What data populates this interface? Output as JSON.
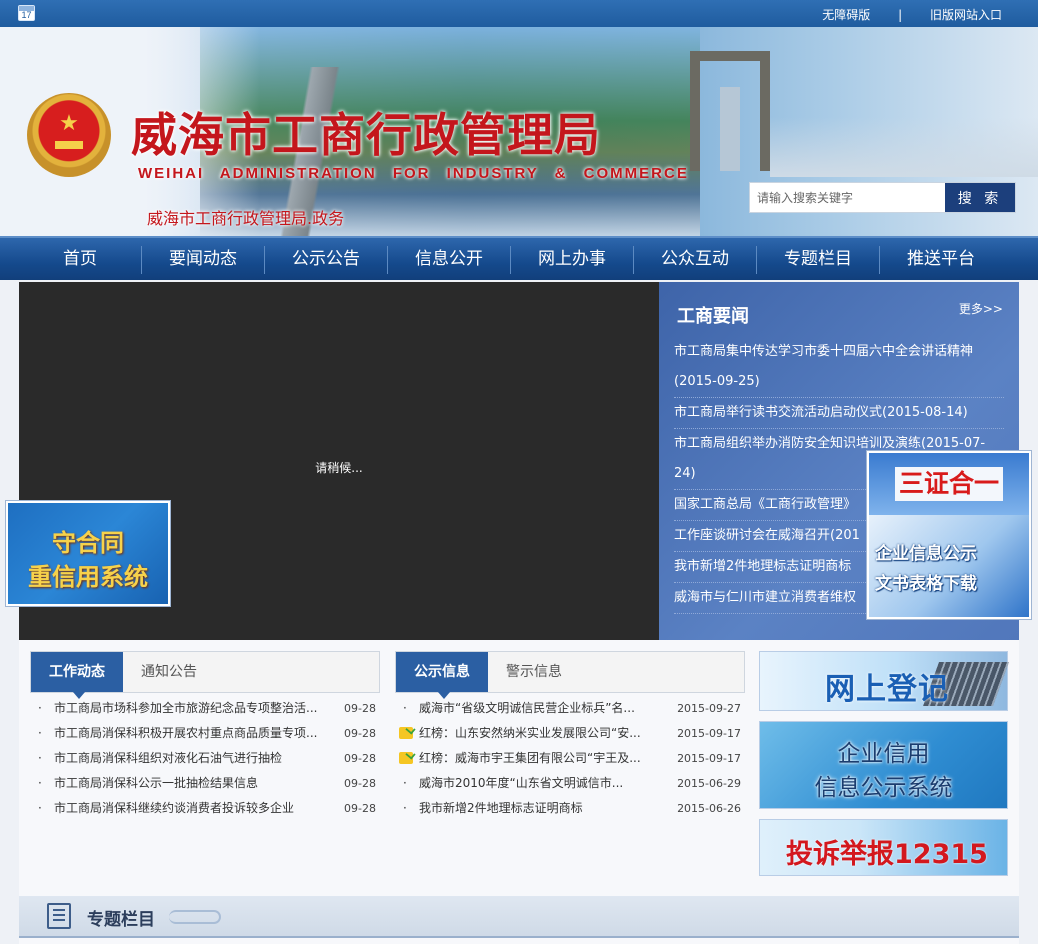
{
  "topbar": {
    "calendar_day": "17",
    "links": [
      "无障碍版",
      "旧版网站入口"
    ],
    "separator": "|"
  },
  "header": {
    "title": "威海市工商行政管理局",
    "title_en": "WEIHAI ADMINISTRATION FOR INDUSTRY & COMMERCE",
    "subtitle": "威海市工商行政管理局.政务",
    "search_placeholder": "请输入搜索关键字",
    "search_button": "搜 索"
  },
  "nav": {
    "items": [
      "首页",
      "要闻动态",
      "公示公告",
      "信息公开",
      "网上办事",
      "公众互动",
      "专题栏目",
      "推送平台"
    ]
  },
  "slider": {
    "loading_text": "请稍候..."
  },
  "news_panel": {
    "title": "工商要闻",
    "more": "更多>>",
    "items": [
      "市工商局集中传达学习市委十四届六中全会讲话精神(2015-09-25)",
      "市工商局举行读书交流活动启动仪式(2015-08-14)",
      "市工商局组织举办消防安全知识培训及演练(2015-07-24)",
      "国家工商总局《工商行政管理》",
      "工作座谈研讨会在威海召开(201",
      "我市新增2件地理标志证明商标",
      "威海市与仁川市建立消费者维权"
    ]
  },
  "float_left": {
    "line1": "守合同",
    "line2": "重信用系统"
  },
  "float_right": {
    "title": "三证合一",
    "line1": "企业信息公示",
    "line2": "文书表格下载"
  },
  "work_box": {
    "tabs": [
      "工作动态",
      "通知公告"
    ],
    "items": [
      {
        "text": "市工商局市场科参加全市旅游纪念品专项整治活...",
        "date": "09-28"
      },
      {
        "text": "市工商局消保科积极开展农村重点商品质量专项...",
        "date": "09-28"
      },
      {
        "text": "市工商局消保科组织对液化石油气进行抽检",
        "date": "09-28"
      },
      {
        "text": "市工商局消保科公示一批抽检结果信息",
        "date": "09-28"
      },
      {
        "text": "市工商局消保科继续约谈消费者投诉较多企业",
        "date": "09-28"
      }
    ]
  },
  "public_box": {
    "tabs": [
      "公示信息",
      "警示信息"
    ],
    "items": [
      {
        "text": "威海市“省级文明诚信民营企业标兵”名...",
        "date": "2015-09-27",
        "icon": "dot"
      },
      {
        "text": "红榜：山东安然纳米实业发展限公司“安...",
        "date": "2015-09-17",
        "icon": "folder-icon"
      },
      {
        "text": "红榜：威海市宇王集团有限公司“宇王及...",
        "date": "2015-09-17",
        "icon": "folder-icon"
      },
      {
        "text": "威海市2010年度“山东省文明诚信市...",
        "date": "2015-06-29",
        "icon": "dot"
      },
      {
        "text": "我市新增2件地理标志证明商标",
        "date": "2015-06-26",
        "icon": "dot"
      }
    ]
  },
  "right_banners": {
    "register": "网上登记",
    "credit_line1": "企业信用",
    "credit_line2": "信息公示系统",
    "complaint": "投诉举报12315"
  },
  "special": {
    "label": "专题栏目"
  },
  "colors": {
    "primary": "#1f5c9f",
    "nav": "#154a8d",
    "title_red": "#c4161c",
    "tab_active": "#2b5fa3"
  }
}
